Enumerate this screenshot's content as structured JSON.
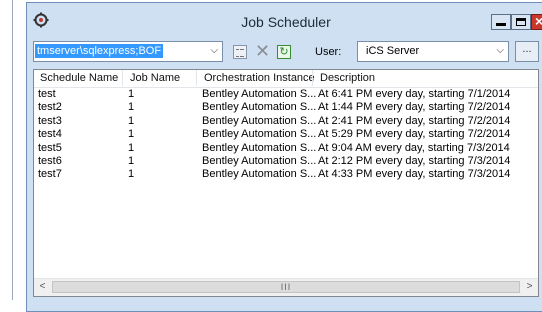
{
  "window": {
    "title": "Job Scheduler"
  },
  "toolbar": {
    "server_value": "tmserver\\sqlexpress;BOF",
    "user_label": "User:",
    "user_value": "iCS Server",
    "browse_label": "..."
  },
  "table": {
    "columns": [
      "Schedule Name",
      "Job Name",
      "Orchestration Instance",
      "Description"
    ],
    "rows": [
      [
        "test",
        "1",
        "Bentley Automation S...",
        "At 6:41 PM every day, starting 7/1/2014"
      ],
      [
        "test2",
        "1",
        "Bentley Automation S...",
        "At 1:44 PM every day, starting 7/2/2014"
      ],
      [
        "test3",
        "1",
        "Bentley Automation S...",
        "At 2:41 PM every day, starting 7/2/2014"
      ],
      [
        "test4",
        "1",
        "Bentley Automation S...",
        "At 5:29 PM every day, starting 7/2/2014"
      ],
      [
        "test5",
        "1",
        "Bentley Automation S...",
        "At 9:04 AM every day, starting 7/3/2014"
      ],
      [
        "test6",
        "1",
        "Bentley Automation S...",
        "At 2:12 PM every day, starting 7/3/2014"
      ],
      [
        "test7",
        "1",
        "Bentley Automation S...",
        "At 4:33 PM every day, starting 7/3/2014"
      ]
    ]
  },
  "scrollbar": {
    "left_arrow": "<",
    "right_arrow": ">",
    "grip": "III"
  },
  "colors": {
    "window_bg": "#cfe0f2",
    "selection": "#3399ff",
    "close_button": "#c9382a"
  }
}
